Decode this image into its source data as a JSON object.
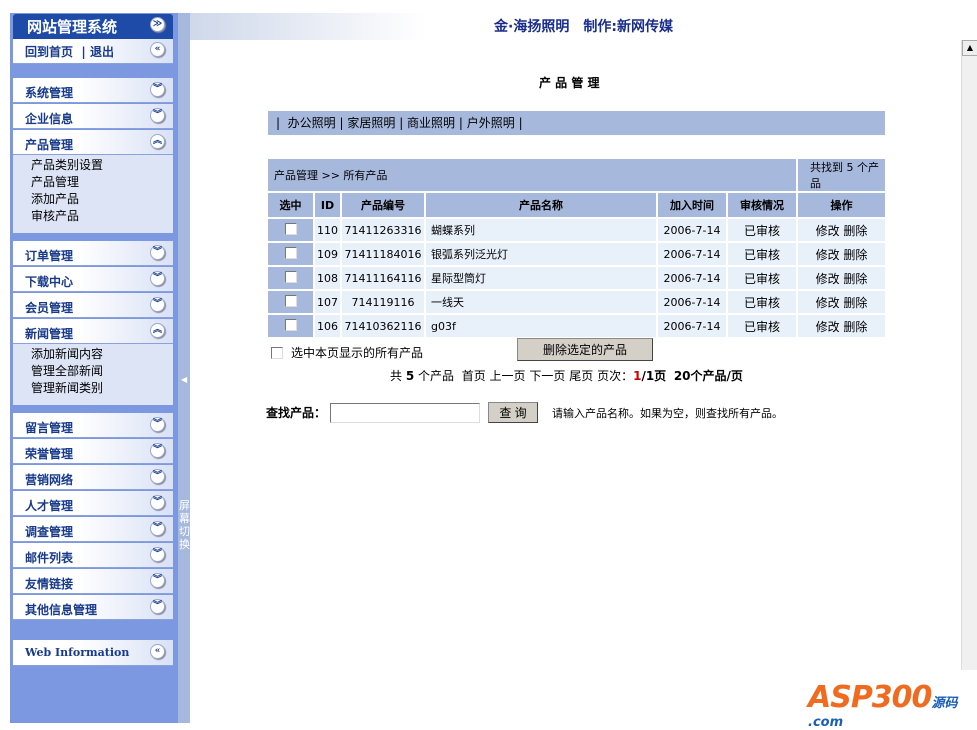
{
  "sidebar": {
    "title": "网站管理系统",
    "home": "回到首页",
    "logout": "退出",
    "groups": [
      {
        "label": "系统管理"
      },
      {
        "label": "企业信息"
      },
      {
        "label": "产品管理",
        "items": [
          "产品类别设置",
          "产品管理",
          "添加产品",
          "审核产品"
        ]
      },
      {
        "label": "订单管理"
      },
      {
        "label": "下载中心"
      },
      {
        "label": "会员管理"
      },
      {
        "label": "新闻管理",
        "items": [
          "添加新闻内容",
          "管理全部新闻",
          "管理新闻类别"
        ]
      },
      {
        "label": "留言管理"
      },
      {
        "label": "荣誉管理"
      },
      {
        "label": "营销网络"
      },
      {
        "label": "人才管理"
      },
      {
        "label": "调查管理"
      },
      {
        "label": "邮件列表"
      },
      {
        "label": "友情链接"
      },
      {
        "label": "其他信息管理"
      }
    ],
    "web_info": "Web Information",
    "toggle": "屏幕切换"
  },
  "header": {
    "title": "金·海扬照明　制作:新网传媒"
  },
  "page": {
    "title": "产 品 管 理",
    "categories": [
      "办公照明",
      "家居照明",
      "商业照明",
      "户外照明"
    ],
    "breadcrumb": "产品管理 >> 所有产品",
    "found": "共找到 5 个产品",
    "columns": [
      "选中",
      "ID",
      "产品编号",
      "产品名称",
      "加入时间",
      "审核情况",
      "操作"
    ],
    "rows": [
      {
        "id": "110",
        "code": "71411263316",
        "name": "蝴蝶系列",
        "date": "2006-7-14",
        "status": "已审核",
        "edit": "修改",
        "del": "删除"
      },
      {
        "id": "109",
        "code": "71411184016",
        "name": "银弧系列泛光灯",
        "date": "2006-7-14",
        "status": "已审核",
        "edit": "修改",
        "del": "删除"
      },
      {
        "id": "108",
        "code": "71411164116",
        "name": "星际型筒灯",
        "date": "2006-7-14",
        "status": "已审核",
        "edit": "修改",
        "del": "删除"
      },
      {
        "id": "107",
        "code": "714119116",
        "name": "一线天",
        "date": "2006-7-14",
        "status": "已审核",
        "edit": "修改",
        "del": "删除"
      },
      {
        "id": "106",
        "code": "71410362116",
        "name": "g03f",
        "date": "2006-7-14",
        "status": "已审核",
        "edit": "修改",
        "del": "删除"
      }
    ],
    "select_all": "选中本页显示的所有产品",
    "delete_selected": "删除选定的产品",
    "pager": {
      "total_pre": "共",
      "total": "5",
      "total_post": "个产品",
      "first": "首页",
      "prev": "上一页",
      "next": "下一页",
      "last": "尾页",
      "page_label": "页次：",
      "current": "1",
      "pages": "/1页",
      "per_page": "20个产品/页"
    },
    "search": {
      "label": "查找产品：",
      "value": "",
      "button": "查 询",
      "hint": "请输入产品名称。如果为空，则查找所有产品。"
    }
  },
  "watermark": "ASP300源码 .com"
}
